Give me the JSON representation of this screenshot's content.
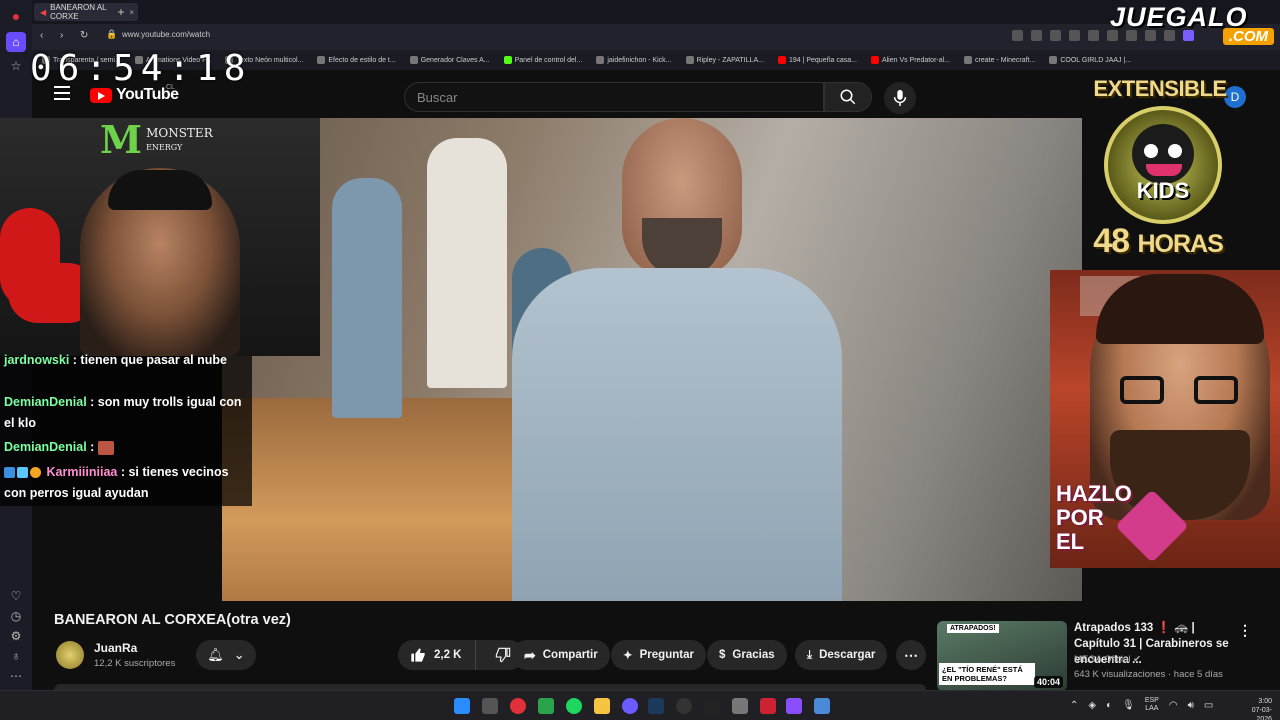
{
  "browser": {
    "tab_title": "BANEARON AL CORXE",
    "url": "www.youtube.com/watch",
    "bookmarks": [
      "Transparenta / semi...",
      "Animations Video F...",
      "Texto Neón multicol...",
      "Efecto de estilo de t...",
      "Generador Claves A...",
      "Panel de control del...",
      "jaidefinichon - Kick...",
      "Ripley - ZAPATILLA...",
      "194 | Pequeña casa...",
      "Alien Vs Predator-al...",
      "create - Minecraft...",
      "COOL GIRLD JAAJ |..."
    ]
  },
  "overlay": {
    "clock": "06:54:18",
    "brand_top": "JUEGALO",
    "brand_bottom": ".COM",
    "monster_line1": "MONSTER",
    "monster_line2": "ENERGY",
    "extensible_title": "EXTENSIBLE",
    "extensible_kids": "KIDS",
    "extensible_hours_num": "48",
    "extensible_hours_label": "HORAS",
    "donation_text_1": "HAZLO",
    "donation_text_2": "POR",
    "donation_text_3": "EL"
  },
  "chat": {
    "messages": [
      {
        "user": "jardnowski",
        "text": ": tienen que pasar al nube"
      },
      {
        "user": "DemianDenial",
        "text": ": son muy trolls igual con el klo"
      },
      {
        "user": "DemianDenial",
        "text": ":"
      },
      {
        "user": "Karmiiiniiaa",
        "text": ": si tienes vecinos con perros igual ayudan"
      }
    ]
  },
  "youtube": {
    "logo_text": "YouTube",
    "country": "CL",
    "search_placeholder": "Buscar",
    "avatar_letter": "D",
    "video_title": "BANEARON AL CORXEA(otra vez)",
    "channel_name": "JuanRa",
    "channel_subs": "12,2 K suscriptores",
    "like_count": "2,2 K",
    "share_label": "Compartir",
    "ask_label": "Preguntar",
    "thanks_label": "Gracias",
    "download_label": "Descargar"
  },
  "recommended": {
    "title": "Atrapados 133 ❗ 🚓 | Capítulo 31 | Carabineros se encuentra ...",
    "channel": "MEGA Oficial",
    "stats": "643 K visualizaciones · hace 5 días",
    "duration": "40:04",
    "thumb_tag": "ATRAPADOS!",
    "thumb_banner": "¿EL \"TÍO RENÉ\" ESTÁ EN PROBLEMAS?"
  },
  "taskbar": {
    "lang_1": "ESP",
    "lang_2": "LAA",
    "time": "3:00",
    "date": "07-03-2026"
  },
  "colors": {
    "yt_red": "#ff0000",
    "chat_name": "#7cffa1",
    "brand_orange": "#f5a200"
  }
}
